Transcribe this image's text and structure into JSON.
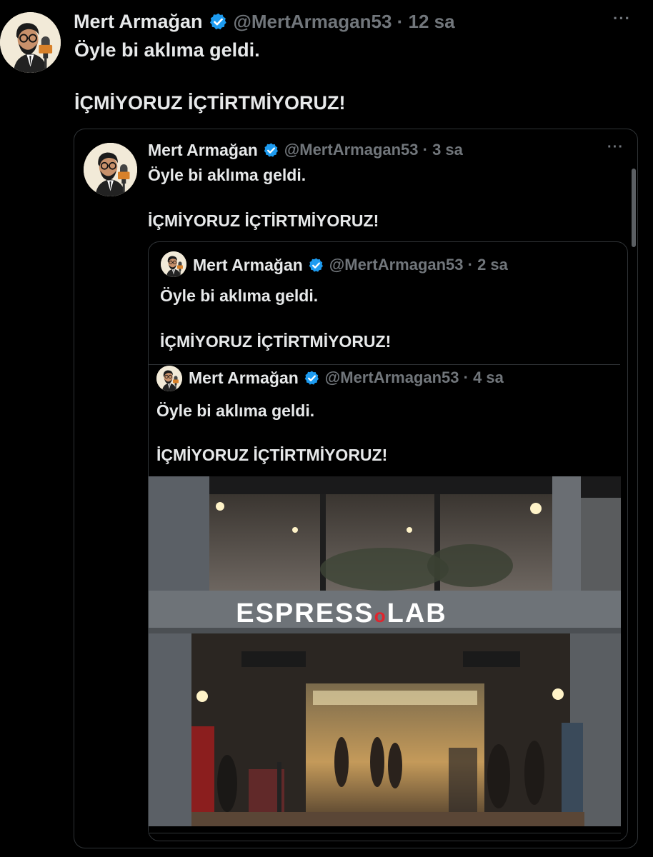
{
  "tweet": {
    "author_name": "Mert Armağan",
    "handle_time": "@MertArmagan53 · 12 sa",
    "line1": "Öyle bi aklıma geldi.",
    "line2": "İÇMİYORUZ İÇTİRTMİYORUZ!",
    "more": "···"
  },
  "quote1": {
    "author_name": "Mert Armağan",
    "handle_time": "@MertArmagan53 · 3 sa",
    "line1": "Öyle bi aklıma geldi.",
    "line2": "İÇMİYORUZ İÇTİRTMİYORUZ!",
    "more": "···"
  },
  "quote2": {
    "author_name": "Mert Armağan",
    "handle_time": "@MertArmagan53 · 2 sa",
    "line1": "Öyle bi aklıma geldi.",
    "line2": "İÇMİYORUZ İÇTİRTMİYORUZ!"
  },
  "quote3": {
    "author_name": "Mert Armağan",
    "handle_time": "@MertArmagan53 · 4 sa",
    "line1": "Öyle bi aklıma geldi.",
    "line2": "İÇMİYORUZ İÇTİRTMİYORUZ!"
  },
  "photo": {
    "sign": "ESPRESSOLAB",
    "sign_left": "ESPRESS",
    "sign_o": "o",
    "sign_right": "LAB"
  },
  "colors": {
    "background": "#000000",
    "text": "#e7e9ea",
    "muted": "#71767b",
    "verified": "#1d9bf0",
    "border": "#2f3336"
  },
  "icons": {
    "verified": "verified-badge-icon",
    "more": "more-options-icon"
  }
}
